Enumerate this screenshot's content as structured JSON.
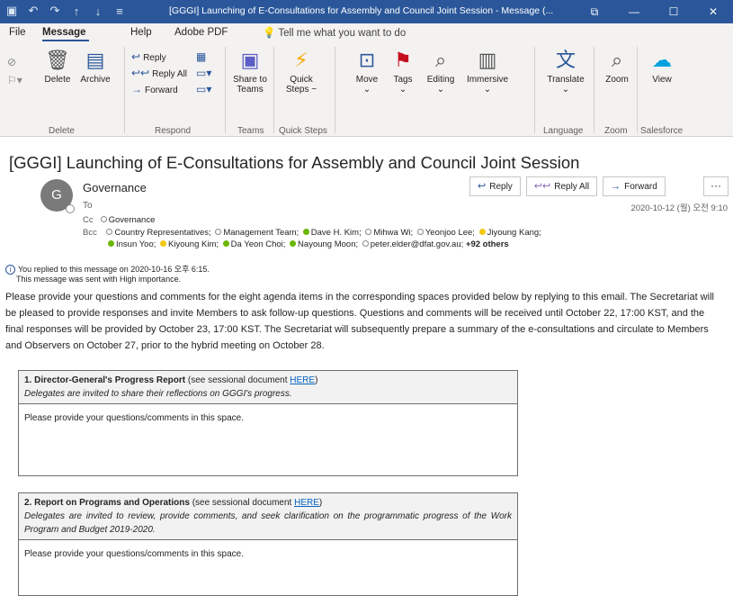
{
  "window": {
    "title": "[GGGI] Launching of E-Consultations for Assembly and Council Joint Session  -  Message (...",
    "controls": {
      "restore": "⧉",
      "minimize": "—",
      "maximize": "☐",
      "close": "✕"
    }
  },
  "menu": {
    "file": "File",
    "message": "Message",
    "help": "Help",
    "adobe": "Adobe PDF",
    "tell_me": "Tell me what you want to do"
  },
  "ribbon": {
    "delete": "Delete",
    "archive": "Archive",
    "reply": "Reply",
    "reply_all": "Reply All",
    "forward": "Forward",
    "share_teams_1": "Share to",
    "share_teams_2": "Teams",
    "quick_steps_1": "Quick",
    "quick_steps_2": "Steps ~",
    "move": "Move",
    "tags": "Tags",
    "editing": "Editing",
    "immersive": "Immersive",
    "translate": "Translate",
    "zoom": "Zoom",
    "view": "View",
    "groups": {
      "delete": "Delete",
      "respond": "Respond",
      "teams": "Teams",
      "quick_steps": "Quick Steps",
      "language": "Language",
      "zoom": "Zoom",
      "salesforce": "Salesforce"
    }
  },
  "message": {
    "subject": "[GGGI] Launching of E-Consultations for Assembly and Council Joint Session",
    "avatar_letter": "G",
    "sender": "Governance",
    "to_label": "To",
    "cc_label": "Cc",
    "cc_name": "Governance",
    "bcc_label": "Bcc",
    "bcc_line1": [
      {
        "status": "o",
        "name": "Country Representatives;"
      },
      {
        "status": "o",
        "name": "Management Team;"
      },
      {
        "status": "g",
        "name": "Dave H. Kim;"
      },
      {
        "status": "o",
        "name": "Mihwa Wi;"
      },
      {
        "status": "o",
        "name": "Yeonjoo Lee;"
      },
      {
        "status": "y",
        "name": "Jiyoung Kang;"
      }
    ],
    "bcc_line2": [
      {
        "status": "g",
        "name": "Insun Yoo;"
      },
      {
        "status": "y",
        "name": "Kiyoung Kim;"
      },
      {
        "status": "g",
        "name": "Da Yeon Choi;"
      },
      {
        "status": "g",
        "name": "Nayoung Moon;"
      },
      {
        "status": "o",
        "name": "peter.elder@dfat.gov.au;"
      }
    ],
    "bcc_more": "+92 others",
    "actions": {
      "reply": "Reply",
      "reply_all": "Reply All",
      "forward": "Forward",
      "more": "···"
    },
    "datetime": "2020-10-12 (월) 오전 9:10",
    "replied_notice": "You replied to this message on 2020-10-16 오후 6:15.",
    "importance_notice": "This message was sent with High importance.",
    "body_text": "Please provide your questions and comments for the eight agenda items in the corresponding spaces provided below by replying to this email. The Secretariat will be pleased to provide responses and invite Members to ask follow-up questions. Questions and comments will be received until October 22, 17:00 KST, and the final responses will be provided by October 23, 17:00 KST. The Secretariat will subsequently prepare a summary of the e-consultations and circulate to Members and Observers on October 27, prior to the hybrid meeting on October 28.",
    "boxes": [
      {
        "title": "1. Director-General's Progress Report",
        "ref": " (see sessional document ",
        "link": "HERE",
        "close": ")",
        "desc": "Delegates are invited to share their reflections on GGGI's progress.",
        "placeholder": "Please provide your questions/comments in this space."
      },
      {
        "title": "2. Report on Programs and Operations",
        "ref": " (see sessional document ",
        "link": "HERE",
        "close": ")",
        "desc": "Delegates are invited to review, provide comments, and seek clarification on the programmatic progress of the Work Program and Budget 2019-2020.",
        "placeholder": "Please provide your questions/comments in this space."
      }
    ]
  },
  "colors": {
    "titlebar": "#2b579a",
    "ribbon": "#f3f2f1",
    "link": "#0563c1"
  }
}
